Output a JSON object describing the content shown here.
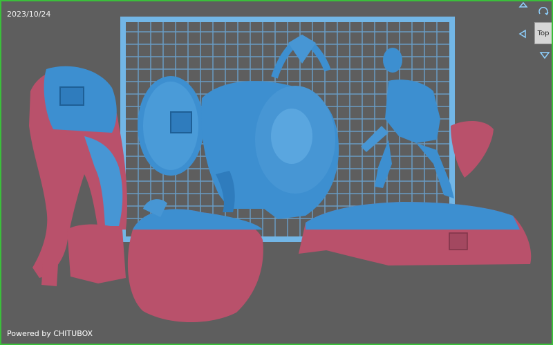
{
  "overlay": {
    "date": "2023/10/24",
    "footer": "Powered by CHITUBOX"
  },
  "view_cube": {
    "top_label": "Top",
    "icons": [
      "arrow-up-icon",
      "rotate-icon",
      "arrow-left-icon",
      "arrow-down-icon"
    ]
  },
  "colors": {
    "background": "#5e5e5e",
    "build_plate": "#6fb0e0",
    "model_blue": "#3d8fd0",
    "model_red": "#b9516b",
    "frame_border": "#3bbf3b"
  }
}
